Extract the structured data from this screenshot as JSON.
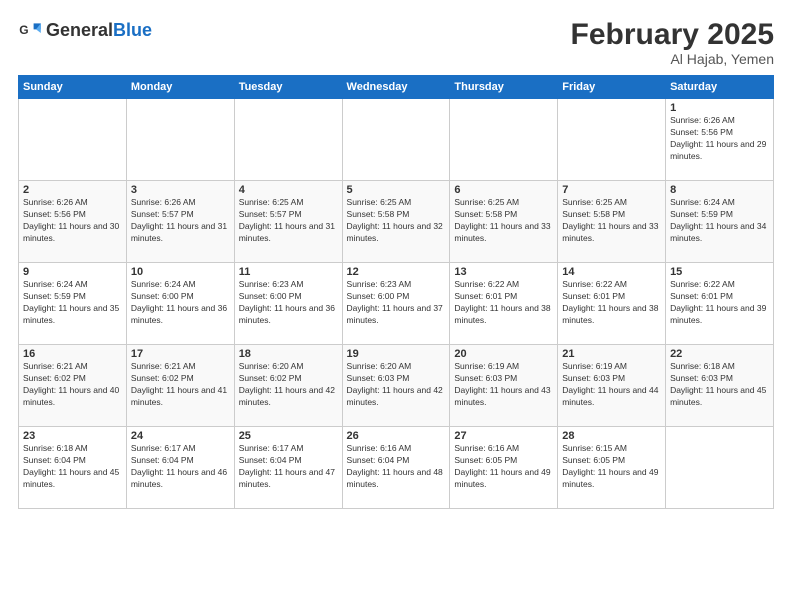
{
  "logo": {
    "general": "General",
    "blue": "Blue"
  },
  "title": "February 2025",
  "subtitle": "Al Hajab, Yemen",
  "days_of_week": [
    "Sunday",
    "Monday",
    "Tuesday",
    "Wednesday",
    "Thursday",
    "Friday",
    "Saturday"
  ],
  "weeks": [
    [
      {
        "day": null
      },
      {
        "day": null
      },
      {
        "day": null
      },
      {
        "day": null
      },
      {
        "day": null
      },
      {
        "day": null
      },
      {
        "day": 1,
        "sunrise": "6:26 AM",
        "sunset": "5:56 PM",
        "daylight": "11 hours and 29 minutes."
      }
    ],
    [
      {
        "day": 2,
        "sunrise": "6:26 AM",
        "sunset": "5:56 PM",
        "daylight": "11 hours and 30 minutes."
      },
      {
        "day": 3,
        "sunrise": "6:26 AM",
        "sunset": "5:57 PM",
        "daylight": "11 hours and 31 minutes."
      },
      {
        "day": 4,
        "sunrise": "6:25 AM",
        "sunset": "5:57 PM",
        "daylight": "11 hours and 31 minutes."
      },
      {
        "day": 5,
        "sunrise": "6:25 AM",
        "sunset": "5:58 PM",
        "daylight": "11 hours and 32 minutes."
      },
      {
        "day": 6,
        "sunrise": "6:25 AM",
        "sunset": "5:58 PM",
        "daylight": "11 hours and 33 minutes."
      },
      {
        "day": 7,
        "sunrise": "6:25 AM",
        "sunset": "5:58 PM",
        "daylight": "11 hours and 33 minutes."
      },
      {
        "day": 8,
        "sunrise": "6:24 AM",
        "sunset": "5:59 PM",
        "daylight": "11 hours and 34 minutes."
      }
    ],
    [
      {
        "day": 9,
        "sunrise": "6:24 AM",
        "sunset": "5:59 PM",
        "daylight": "11 hours and 35 minutes."
      },
      {
        "day": 10,
        "sunrise": "6:24 AM",
        "sunset": "6:00 PM",
        "daylight": "11 hours and 36 minutes."
      },
      {
        "day": 11,
        "sunrise": "6:23 AM",
        "sunset": "6:00 PM",
        "daylight": "11 hours and 36 minutes."
      },
      {
        "day": 12,
        "sunrise": "6:23 AM",
        "sunset": "6:00 PM",
        "daylight": "11 hours and 37 minutes."
      },
      {
        "day": 13,
        "sunrise": "6:22 AM",
        "sunset": "6:01 PM",
        "daylight": "11 hours and 38 minutes."
      },
      {
        "day": 14,
        "sunrise": "6:22 AM",
        "sunset": "6:01 PM",
        "daylight": "11 hours and 38 minutes."
      },
      {
        "day": 15,
        "sunrise": "6:22 AM",
        "sunset": "6:01 PM",
        "daylight": "11 hours and 39 minutes."
      }
    ],
    [
      {
        "day": 16,
        "sunrise": "6:21 AM",
        "sunset": "6:02 PM",
        "daylight": "11 hours and 40 minutes."
      },
      {
        "day": 17,
        "sunrise": "6:21 AM",
        "sunset": "6:02 PM",
        "daylight": "11 hours and 41 minutes."
      },
      {
        "day": 18,
        "sunrise": "6:20 AM",
        "sunset": "6:02 PM",
        "daylight": "11 hours and 42 minutes."
      },
      {
        "day": 19,
        "sunrise": "6:20 AM",
        "sunset": "6:03 PM",
        "daylight": "11 hours and 42 minutes."
      },
      {
        "day": 20,
        "sunrise": "6:19 AM",
        "sunset": "6:03 PM",
        "daylight": "11 hours and 43 minutes."
      },
      {
        "day": 21,
        "sunrise": "6:19 AM",
        "sunset": "6:03 PM",
        "daylight": "11 hours and 44 minutes."
      },
      {
        "day": 22,
        "sunrise": "6:18 AM",
        "sunset": "6:03 PM",
        "daylight": "11 hours and 45 minutes."
      }
    ],
    [
      {
        "day": 23,
        "sunrise": "6:18 AM",
        "sunset": "6:04 PM",
        "daylight": "11 hours and 45 minutes."
      },
      {
        "day": 24,
        "sunrise": "6:17 AM",
        "sunset": "6:04 PM",
        "daylight": "11 hours and 46 minutes."
      },
      {
        "day": 25,
        "sunrise": "6:17 AM",
        "sunset": "6:04 PM",
        "daylight": "11 hours and 47 minutes."
      },
      {
        "day": 26,
        "sunrise": "6:16 AM",
        "sunset": "6:04 PM",
        "daylight": "11 hours and 48 minutes."
      },
      {
        "day": 27,
        "sunrise": "6:16 AM",
        "sunset": "6:05 PM",
        "daylight": "11 hours and 49 minutes."
      },
      {
        "day": 28,
        "sunrise": "6:15 AM",
        "sunset": "6:05 PM",
        "daylight": "11 hours and 49 minutes."
      },
      {
        "day": null
      }
    ]
  ]
}
